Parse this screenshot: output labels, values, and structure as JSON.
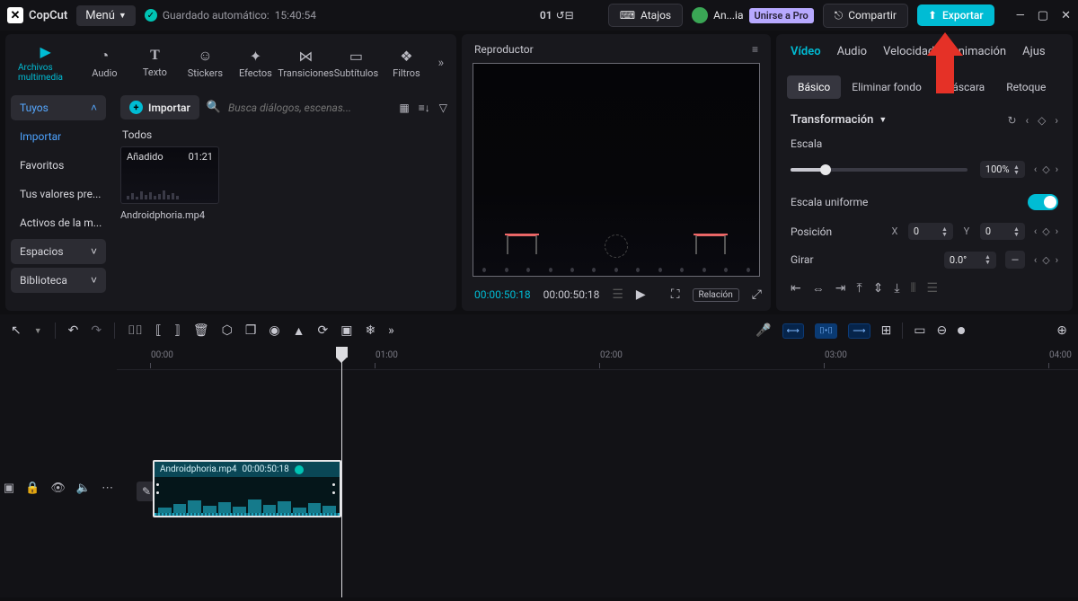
{
  "app": {
    "name": "CopCut",
    "menu_label": "Menú",
    "autosave_prefix": "Guardado automático:",
    "autosave_time": "15:40:54",
    "counter": "01"
  },
  "topbuttons": {
    "shortcuts": "Atajos",
    "username": "An...ia",
    "pro_badge": "Unirse a Pro",
    "share": "Compartir",
    "export": "Exportar"
  },
  "tool_tabs": [
    {
      "label": "Archivos multimedia",
      "icon": "▶"
    },
    {
      "label": "Audio",
      "icon": "◔"
    },
    {
      "label": "Texto",
      "icon": "T"
    },
    {
      "label": "Stickers",
      "icon": "☺"
    },
    {
      "label": "Efectos",
      "icon": "✦"
    },
    {
      "label": "Transiciones",
      "icon": "⋈"
    },
    {
      "label": "Subtítulos",
      "icon": "▭"
    },
    {
      "label": "Filtros",
      "icon": "❖"
    }
  ],
  "sidebar": {
    "items": [
      {
        "label": "Tuyos",
        "kind": "pill-active",
        "chev": "˄"
      },
      {
        "label": "Importar",
        "kind": "link"
      },
      {
        "label": "Favoritos",
        "kind": ""
      },
      {
        "label": "Tus valores pre...",
        "kind": ""
      },
      {
        "label": "Activos de la m...",
        "kind": ""
      },
      {
        "label": "Espacios",
        "kind": "dropdown",
        "chev": "˅"
      },
      {
        "label": "Biblioteca",
        "kind": "dropdown",
        "chev": "˅"
      }
    ]
  },
  "import": {
    "button": "Importar",
    "search_placeholder": "Busca diálogos, escenas...",
    "all_label": "Todos"
  },
  "media": {
    "added_label": "Añadido",
    "duration": "01:21",
    "filename": "Androidphoria.mp4"
  },
  "player": {
    "title": "Reproductor",
    "tc_current": "00:00:50:18",
    "tc_total": "00:00:50:18",
    "ratio": "Relación"
  },
  "inspector": {
    "tabs": [
      "Vídeo",
      "Audio",
      "Velocidad",
      "Animación",
      "Ajus"
    ],
    "subtabs": [
      "Básico",
      "Eliminar fondo",
      "Máscara",
      "Retoque"
    ],
    "section_transform": "Transformación",
    "scale_label": "Escala",
    "scale_value": "100%",
    "uniform_label": "Escala uniforme",
    "position_label": "Posición",
    "pos_x_label": "X",
    "pos_x_value": "0",
    "pos_y_label": "Y",
    "pos_y_value": "0",
    "rotate_label": "Girar",
    "rotate_value": "0.0°"
  },
  "timeline": {
    "ticks": [
      "00:00",
      "01:00",
      "02:00",
      "03:00",
      "04:00"
    ],
    "clip_name": "Androidphoria.mp4",
    "clip_tc": "00:00:50:18"
  }
}
